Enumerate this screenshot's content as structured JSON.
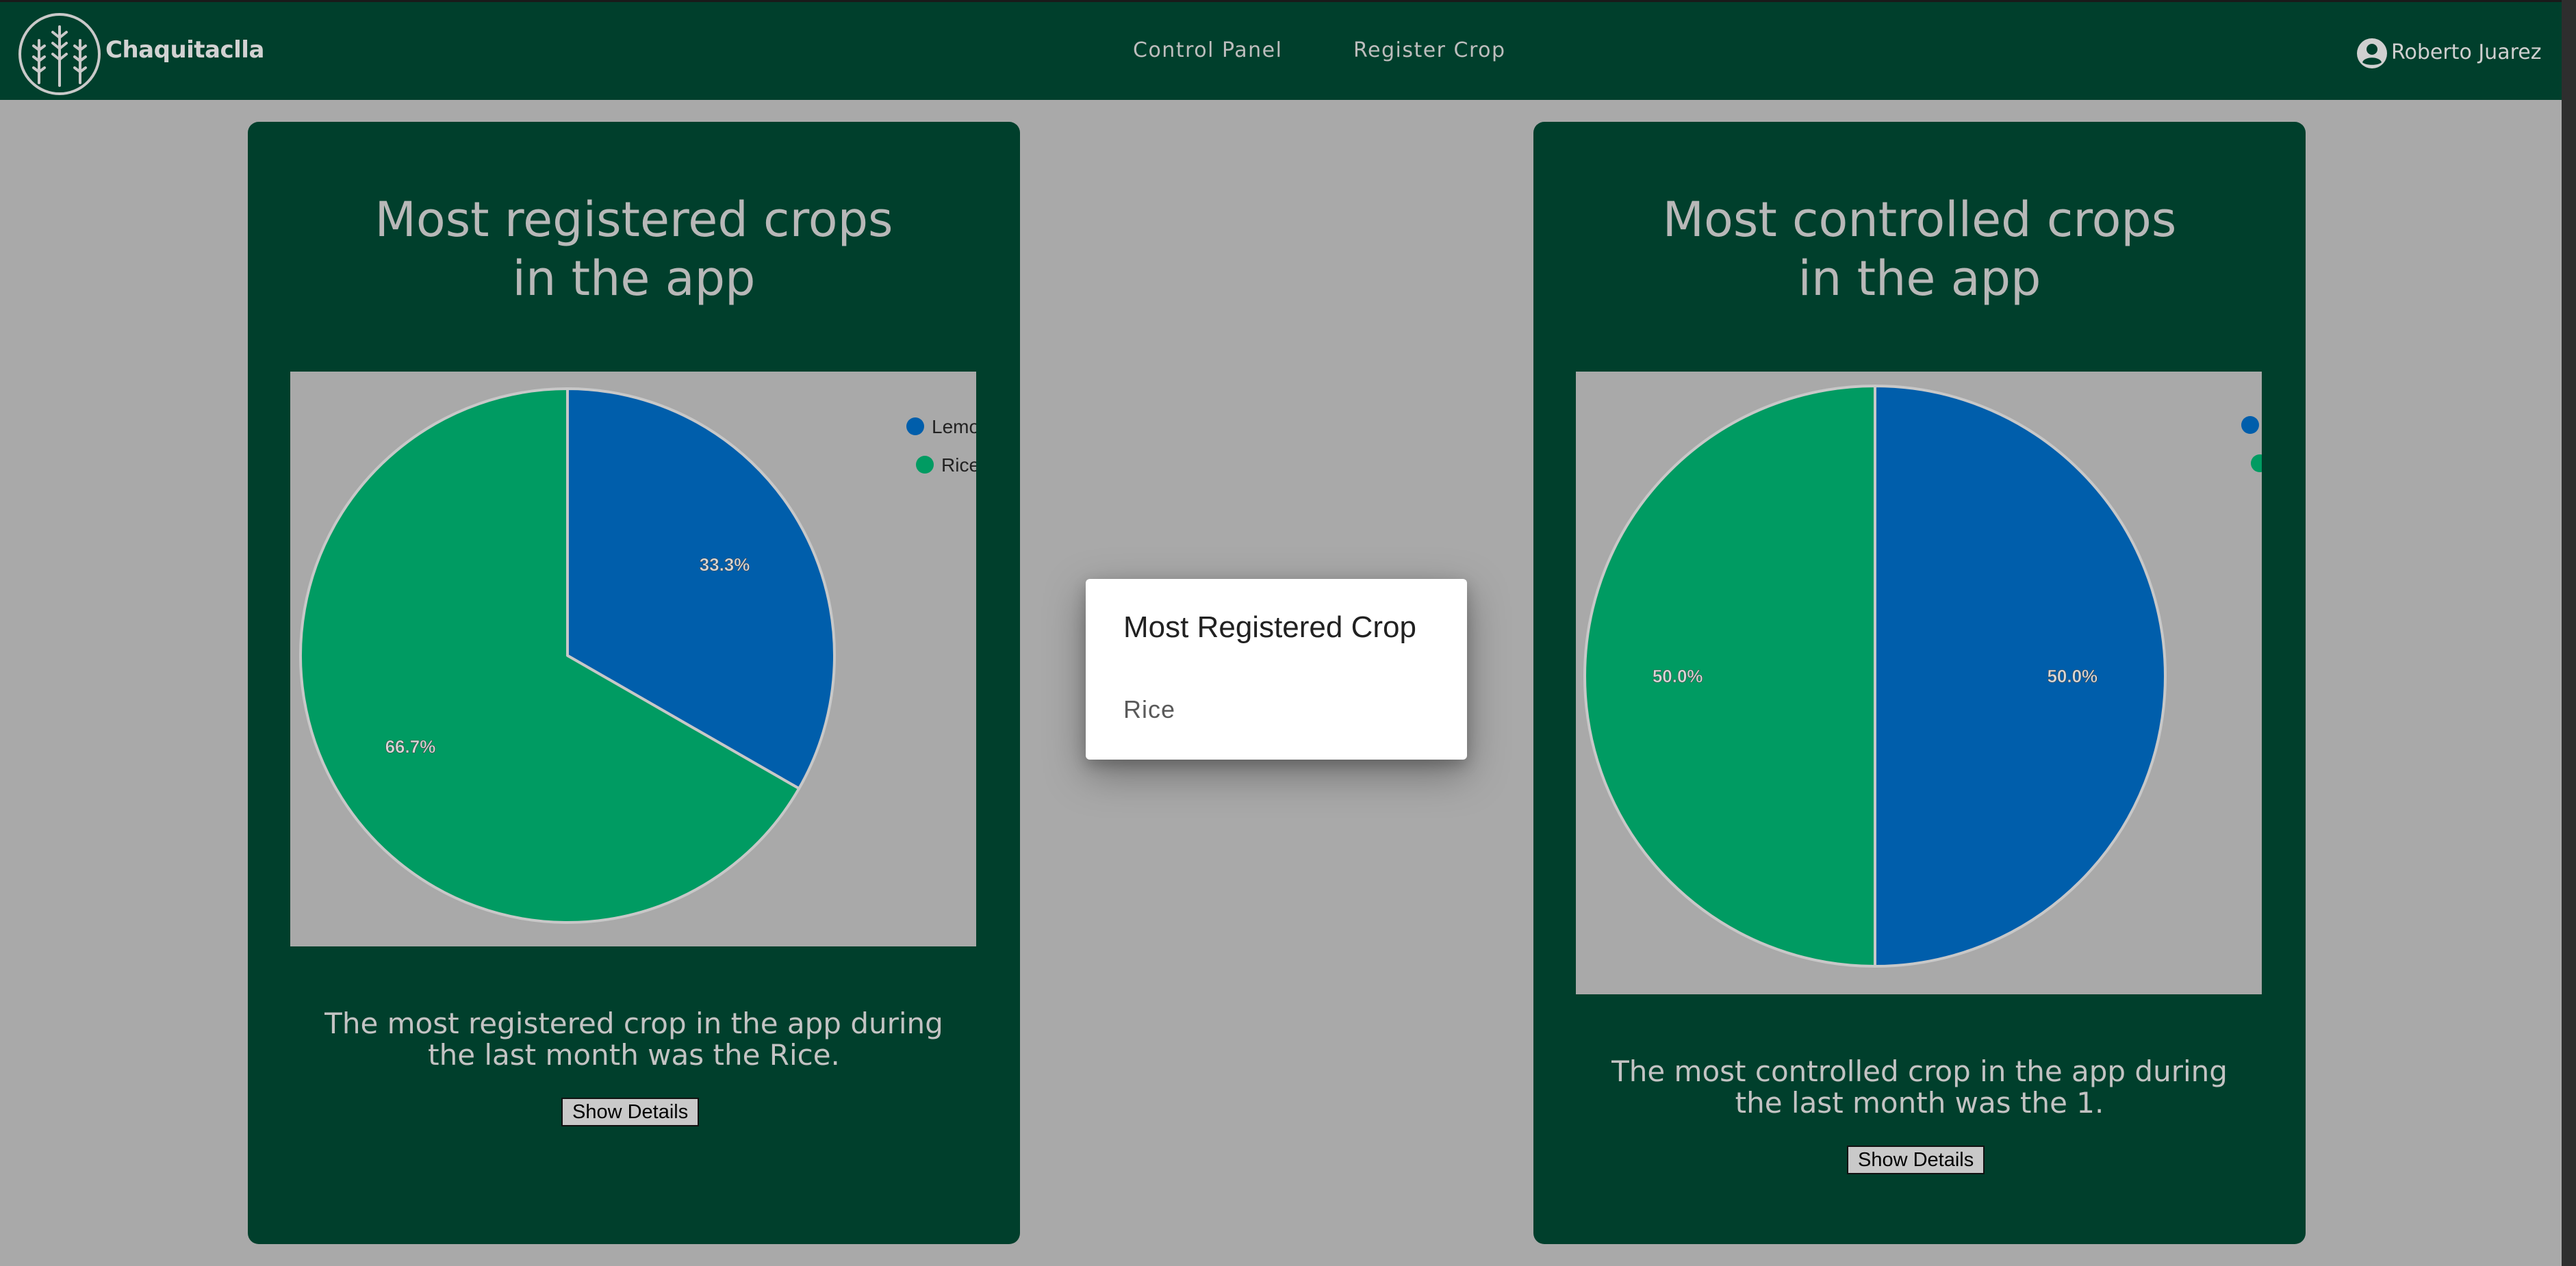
{
  "navbar": {
    "brand": "Chaquitaclla",
    "links": [
      "Control Panel",
      "Register Crop"
    ],
    "user_name": "Roberto Juarez",
    "logo_icon": "wheat-logo-icon",
    "user_icon": "account-circle-icon"
  },
  "colors": {
    "navbar_bg": "#003f2c",
    "page_bg": "#a9a9a9",
    "series_blue": "#005eab",
    "series_green": "#009b62"
  },
  "cards": [
    {
      "title_lines": [
        "Most registered crops",
        "in the app"
      ],
      "summary_lines": [
        "The most registered crop in the app during",
        "the last month was the Rice."
      ],
      "button_label": "Show Details"
    },
    {
      "title_lines": [
        "Most controlled crops",
        "in the app"
      ],
      "summary_lines": [
        "The most controlled crop in the app during",
        "the last month was the 1."
      ],
      "button_label": "Show Details"
    }
  ],
  "chart_data": [
    {
      "type": "pie",
      "categories": [
        "Lemo",
        "Rice"
      ],
      "values": [
        33.3,
        66.7
      ],
      "labels": [
        "33.3%",
        "66.7%"
      ],
      "colors": [
        "#005eab",
        "#009b62"
      ],
      "legend": "top-right"
    },
    {
      "type": "pie",
      "categories": [
        "",
        ""
      ],
      "values": [
        50.0,
        50.0
      ],
      "labels": [
        "50.0%",
        "50.0%"
      ],
      "colors": [
        "#005eab",
        "#009b62"
      ],
      "legend": "top-right"
    }
  ],
  "modal": {
    "title": "Most Registered Crop",
    "value": "Rice"
  }
}
